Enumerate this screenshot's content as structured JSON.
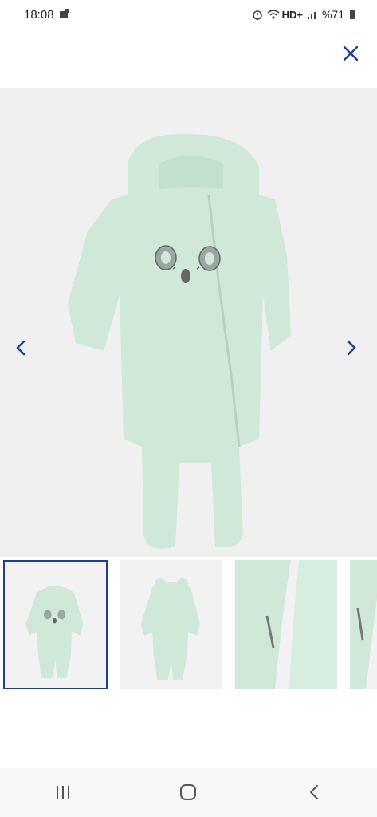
{
  "status_bar": {
    "time": "18:08",
    "network": "HD+",
    "battery": "%71"
  },
  "top_bar": {
    "close_icon": "close-icon",
    "accent_color": "#1f3f8f"
  },
  "gallery": {
    "prev_icon": "chevron-left-icon",
    "next_icon": "chevron-right-icon",
    "product_color": "#cfe8d8",
    "thumbnails": [
      {
        "view": "front",
        "selected": true
      },
      {
        "view": "back",
        "selected": false
      },
      {
        "view": "zipper-detail",
        "selected": false
      },
      {
        "view": "side-detail",
        "selected": false
      }
    ]
  },
  "system_nav": {
    "recents_icon": "recents-icon",
    "home_icon": "home-icon",
    "back_icon": "back-icon"
  }
}
